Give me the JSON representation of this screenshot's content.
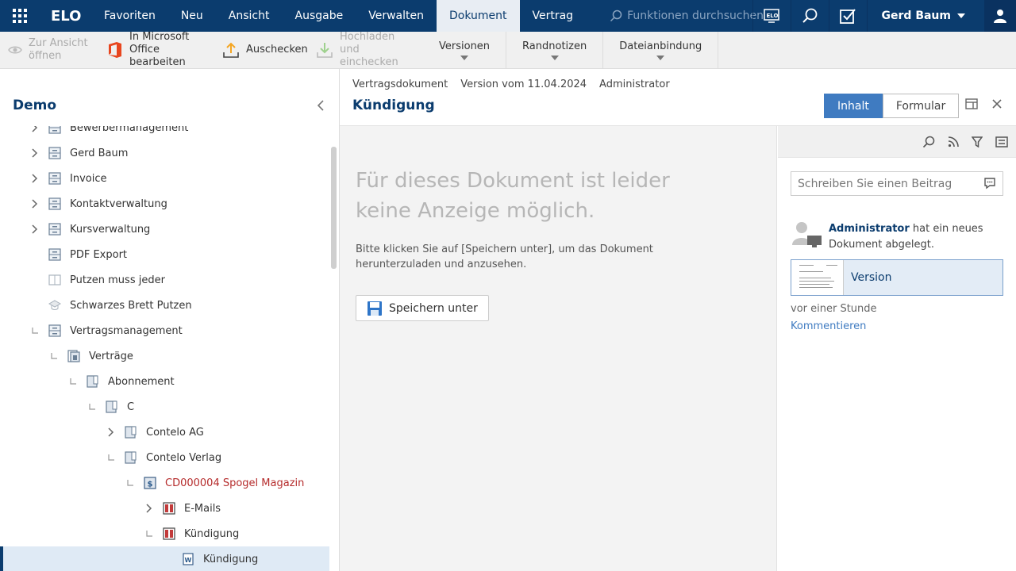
{
  "topbar": {
    "brand": "ELO",
    "nav": [
      "Favoriten",
      "Neu",
      "Ansicht",
      "Ausgabe",
      "Verwalten",
      "Dokument",
      "Vertrag"
    ],
    "active_nav": "Dokument",
    "search_placeholder": "Funktionen durchsuchen",
    "user_name": "Gerd Baum",
    "colors": {
      "bar": "#0b3c6e",
      "active_tab_bg": "#e8edf3"
    }
  },
  "toolbar": {
    "open_view_label": "Zur Ansicht öffnen",
    "office_edit_label": "In Microsoft Office bearbeiten",
    "checkout_label": "Auschecken",
    "upload_label": "Hochladen und einchecken",
    "versions_label": "Versionen",
    "margin_notes_label": "Randnotizen",
    "file_link_label": "Dateianbindung"
  },
  "left": {
    "title": "Demo",
    "tree": [
      {
        "label": "Bewerbermanagement",
        "toggle": "collapsed",
        "icon": "archive-cabinet-icon"
      },
      {
        "label": "Gerd Baum",
        "toggle": "collapsed",
        "icon": "archive-cabinet-icon"
      },
      {
        "label": "Invoice",
        "toggle": "collapsed",
        "icon": "archive-cabinet-icon"
      },
      {
        "label": "Kontaktverwaltung",
        "toggle": "collapsed",
        "icon": "archive-cabinet-icon"
      },
      {
        "label": "Kursverwaltung",
        "toggle": "collapsed",
        "icon": "archive-cabinet-icon"
      },
      {
        "label": "PDF Export",
        "toggle": "none",
        "icon": "archive-cabinet-icon"
      },
      {
        "label": "Putzen muss jeder",
        "toggle": "none",
        "icon": "book-icon"
      },
      {
        "label": "Schwarzes Brett Putzen",
        "toggle": "none",
        "icon": "graduation-cap-icon"
      },
      {
        "label": "Vertragsmanagement",
        "toggle": "expanded",
        "icon": "archive-cabinet-icon"
      },
      {
        "label": "Verträge",
        "toggle": "expanded",
        "icon": "folder-stack-icon"
      },
      {
        "label": "Abonnement",
        "toggle": "expanded",
        "icon": "folder-icon"
      },
      {
        "label": "C",
        "toggle": "expanded",
        "icon": "folder-icon"
      },
      {
        "label": "Contelo AG",
        "toggle": "collapsed",
        "icon": "folder-icon"
      },
      {
        "label": "Contelo Verlag",
        "toggle": "expanded",
        "icon": "folder-icon"
      },
      {
        "label": "CD000004 Spogel Magazin",
        "toggle": "expanded",
        "icon": "contract-folder-icon",
        "highlight": true
      },
      {
        "label": "E-Mails",
        "toggle": "collapsed",
        "icon": "red-binder-icon"
      },
      {
        "label": "Kündigung",
        "toggle": "expanded",
        "icon": "red-binder-icon"
      },
      {
        "label": "Kündigung",
        "toggle": "none",
        "icon": "word-document-icon",
        "selected": true
      }
    ]
  },
  "document": {
    "type": "Vertragsdokument",
    "version": "Version vom 11.04.2024",
    "author": "Administrator",
    "title": "Kündigung",
    "tab_content": "Inhalt",
    "tab_form": "Formular",
    "no_preview": "Für dieses Dokument ist leider keine Anzeige möglich.",
    "hint": "Bitte klicken Sie auf [Speichern unter], um das Dokument herunterzuladen und anzusehen.",
    "save_as_label": "Speichern unter"
  },
  "feed": {
    "post_placeholder": "Schreiben Sie einen Beitrag",
    "entry_author": "Administrator",
    "entry_text": " hat ein neues Dokument abgelegt.",
    "version_label": "Version",
    "time": "vor einer Stunde",
    "comment_label": "Kommentieren"
  }
}
